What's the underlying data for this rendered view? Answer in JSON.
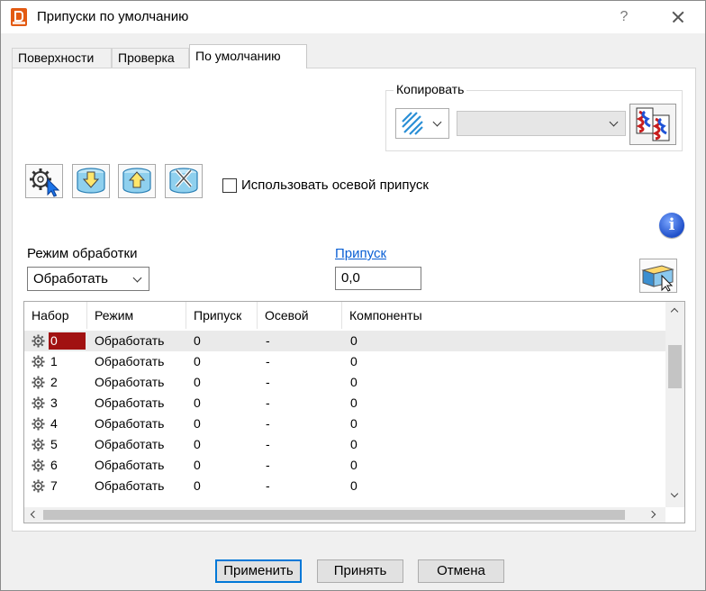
{
  "window": {
    "title": "Припуски по умолчанию",
    "help_label": "?"
  },
  "tabs": [
    {
      "label": "Поверхности",
      "active": false
    },
    {
      "label": "Проверка",
      "active": false
    },
    {
      "label": "По умолчанию",
      "active": true
    }
  ],
  "copy_group": {
    "label": "Копировать",
    "dropdown_value": ""
  },
  "toolbar": {
    "use_axial_label": "Использовать осевой припуск",
    "use_axial_checked": false
  },
  "mode": {
    "label": "Режим обработки",
    "value": "Обработать"
  },
  "allowance": {
    "label": "Припуск",
    "value": "0,0"
  },
  "table": {
    "columns": [
      "Набор",
      "Режим",
      "Припуск",
      "Осевой",
      "Компоненты"
    ],
    "rows": [
      {
        "id": "0",
        "mode": "Обработать",
        "allowance": "0",
        "axial": "-",
        "components": "0"
      },
      {
        "id": "1",
        "mode": "Обработать",
        "allowance": "0",
        "axial": "-",
        "components": "0"
      },
      {
        "id": "2",
        "mode": "Обработать",
        "allowance": "0",
        "axial": "-",
        "components": "0"
      },
      {
        "id": "3",
        "mode": "Обработать",
        "allowance": "0",
        "axial": "-",
        "components": "0"
      },
      {
        "id": "4",
        "mode": "Обработать",
        "allowance": "0",
        "axial": "-",
        "components": "0"
      },
      {
        "id": "5",
        "mode": "Обработать",
        "allowance": "0",
        "axial": "-",
        "components": "0"
      },
      {
        "id": "6",
        "mode": "Обработать",
        "allowance": "0",
        "axial": "-",
        "components": "0"
      },
      {
        "id": "7",
        "mode": "Обработать",
        "allowance": "0",
        "axial": "-",
        "components": "0"
      }
    ]
  },
  "buttons": {
    "apply": "Применить",
    "accept": "Принять",
    "cancel": "Отмена"
  },
  "icons": {
    "app": "powermill-app-icon",
    "copy_mode": "surface-stripes-icon",
    "copy_action": "copy-allowance-icon",
    "select_tool": "select-by-gear-icon",
    "import": "import-cylinder-icon",
    "export": "export-cylinder-icon",
    "reset": "reset-cylinder-icon",
    "info": "info-icon",
    "edit_set": "edit-set-icon",
    "row_gear": "gear-icon"
  },
  "colors": {
    "selected_id_bg": "#a11111",
    "link": "#0a5fd4",
    "info_blue": "#1f4fc9"
  }
}
